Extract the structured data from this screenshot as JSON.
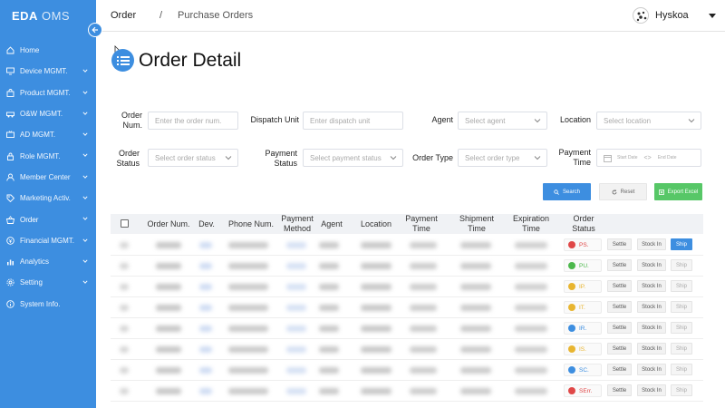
{
  "app": {
    "logo_bold": "EDA",
    "logo_thin": "OMS"
  },
  "sidebar": {
    "items": [
      {
        "label": "Home",
        "icon": "home-icon",
        "chevron": false,
        "active": false
      },
      {
        "label": "Device MGMT.",
        "icon": "monitor-icon",
        "chevron": true,
        "active": false
      },
      {
        "label": "Product MGMT.",
        "icon": "shopping-bag-icon",
        "chevron": true,
        "active": false
      },
      {
        "label": "O&W MGMT.",
        "icon": "car-icon",
        "chevron": true,
        "active": false
      },
      {
        "label": "AD MGMT.",
        "icon": "tv-icon",
        "chevron": true,
        "active": false
      },
      {
        "label": "Role MGMT.",
        "icon": "lock-icon",
        "chevron": true,
        "active": false
      },
      {
        "label": "Member Center",
        "icon": "user-icon",
        "chevron": true,
        "active": false
      },
      {
        "label": "Marketing Activ.",
        "icon": "tag-icon",
        "chevron": true,
        "active": false
      },
      {
        "label": "Order",
        "icon": "basket-icon",
        "chevron": true,
        "active": true
      },
      {
        "label": "Financial MGMT.",
        "icon": "money-icon",
        "chevron": true,
        "active": false
      },
      {
        "label": "Analytics",
        "icon": "chart-icon",
        "chevron": true,
        "active": false
      },
      {
        "label": "Setting",
        "icon": "gear-icon",
        "chevron": true,
        "active": false
      },
      {
        "label": "System Info.",
        "icon": "info-icon",
        "chevron": false,
        "active": false
      }
    ]
  },
  "header": {
    "breadcrumb_root": "Order",
    "breadcrumb_sep": "/",
    "breadcrumb_current": "Purchase Orders",
    "username": "Hyskoa"
  },
  "page": {
    "title": "Order Detail"
  },
  "filters": {
    "order_num": {
      "label1": "Order",
      "label2": "Num.",
      "placeholder": "Enter the order num."
    },
    "dispatch_unit": {
      "label": "Dispatch Unit",
      "placeholder": "Enter dispatch unit"
    },
    "agent": {
      "label": "Agent",
      "placeholder": "Select agent"
    },
    "location": {
      "label": "Location",
      "placeholder": "Select location"
    },
    "order_status": {
      "label1": "Order",
      "label2": "Status",
      "placeholder": "Select order status"
    },
    "payment_status": {
      "label1": "Payment",
      "label2": "Status",
      "placeholder": "Select payment status"
    },
    "order_type": {
      "label": "Order Type",
      "placeholder": "Select order type"
    },
    "payment_time": {
      "label1": "Payment",
      "label2": "Time",
      "start": "Start Date",
      "end": "End Date",
      "sep": "<>"
    }
  },
  "buttons": {
    "search": "Search",
    "reset": "Reset",
    "export": "Export Excel"
  },
  "table": {
    "headers": {
      "order_num": "Order Num.",
      "dev": "Dev.",
      "phone": "Phone Num.",
      "payment_method_1": "Payment",
      "payment_method_2": "Method",
      "agent": "Agent",
      "location": "Location",
      "payment_time_1": "Payment",
      "payment_time_2": "Time",
      "shipment_time_1": "Shipment",
      "shipment_time_2": "Time",
      "expiration_time_1": "Expiration",
      "expiration_time_2": "Time",
      "order_status_1": "Order",
      "order_status_2": "Status"
    },
    "action_labels": {
      "settle": "Settle",
      "stock_in": "Stock In",
      "ship": "Ship"
    },
    "rows": [
      {
        "status": "PS.",
        "status_color": "#e04848",
        "status_icon": "minus-circle-icon",
        "ship_enabled": true
      },
      {
        "status": "PU.",
        "status_color": "#4cb84c",
        "status_icon": "check-circle-icon",
        "ship_enabled": false
      },
      {
        "status": "IP.",
        "status_color": "#e8b530",
        "status_icon": "ellipsis-circle-icon",
        "ship_enabled": false
      },
      {
        "status": "IT.",
        "status_color": "#e8b530",
        "status_icon": "ellipsis-circle-icon",
        "ship_enabled": false
      },
      {
        "status": "IR.",
        "status_color": "#3d8ee0",
        "status_icon": "check-circle-icon",
        "ship_enabled": false
      },
      {
        "status": "IS.",
        "status_color": "#e8b530",
        "status_icon": "ellipsis-circle-icon",
        "ship_enabled": false
      },
      {
        "status": "SC.",
        "status_color": "#3d8ee0",
        "status_icon": "check-circle-icon",
        "ship_enabled": false
      },
      {
        "status": "SErr.",
        "status_color": "#e04848",
        "status_icon": "minus-circle-icon",
        "ship_enabled": false
      }
    ]
  },
  "colors": {
    "brand": "#3d8ee0",
    "export": "#57c767",
    "danger": "#e04848",
    "warning": "#e8b530",
    "success": "#4cb84c"
  }
}
